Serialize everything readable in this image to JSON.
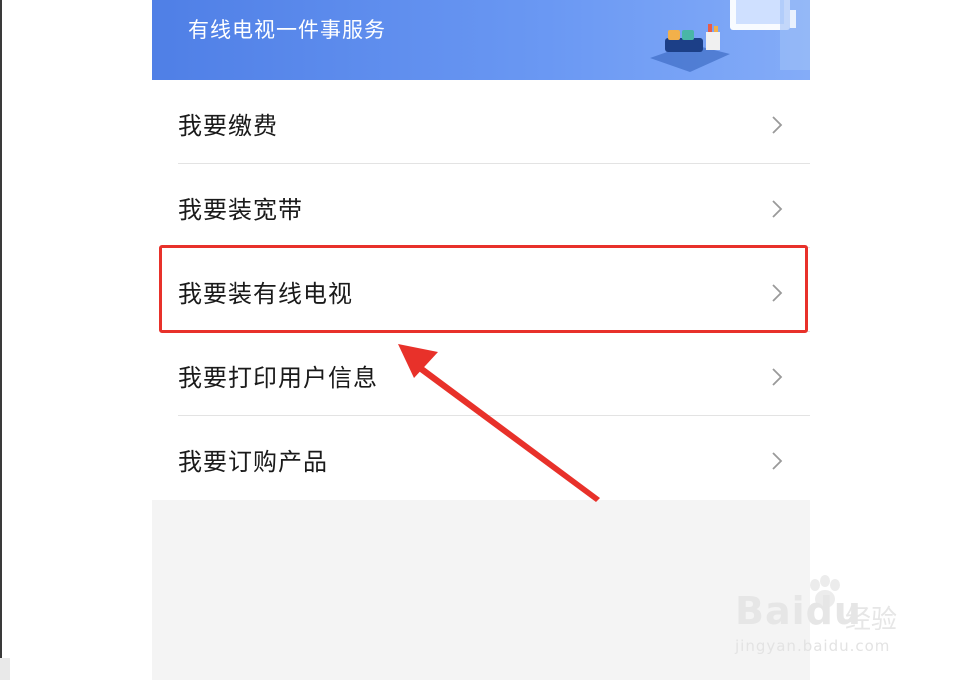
{
  "banner": {
    "title": "有线电视一件事服务"
  },
  "menu": {
    "items": [
      {
        "label": "我要缴费"
      },
      {
        "label": "我要装宽带"
      },
      {
        "label": "我要装有线电视"
      },
      {
        "label": "我要打印用户信息"
      },
      {
        "label": "我要订购产品"
      }
    ]
  },
  "watermark": {
    "logo": "Baidu",
    "sub": "经验",
    "url": "jingyan.baidu.com"
  },
  "colors": {
    "banner": "#5b8bef",
    "annotation": "#e8312a"
  },
  "icons": {
    "chevron": "chevron-right-icon"
  }
}
